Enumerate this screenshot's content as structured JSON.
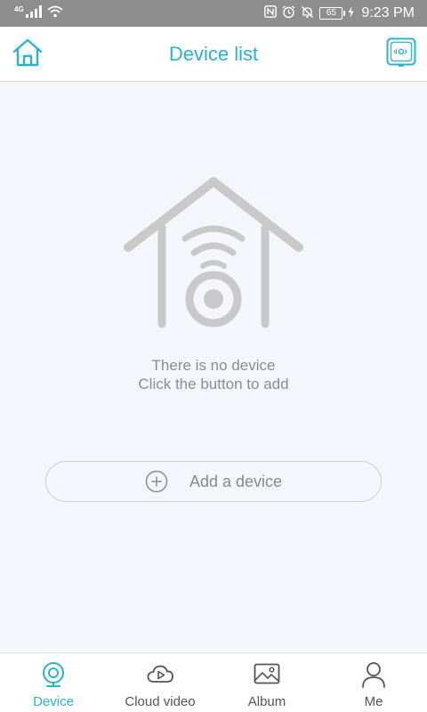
{
  "status_bar": {
    "network": "4G",
    "battery": "65",
    "time": "9:23 PM"
  },
  "header": {
    "title": "Device list",
    "left_icon": "home-icon",
    "right_icon": "scan-icon"
  },
  "empty_state": {
    "line1": "There is no device",
    "line2": "Click the button to add",
    "icon": "house-camera-icon"
  },
  "add_device": {
    "label": "Add a device",
    "icon": "plus-circle-icon"
  },
  "bottom_nav": {
    "items": [
      {
        "label": "Device",
        "icon": "camera-icon",
        "active": true
      },
      {
        "label": "Cloud video",
        "icon": "cloud-play-icon",
        "active": false
      },
      {
        "label": "Album",
        "icon": "image-icon",
        "active": false
      },
      {
        "label": "Me",
        "icon": "person-icon",
        "active": false
      }
    ]
  },
  "colors": {
    "accent": "#28b3cf",
    "background": "#f4f6fb",
    "status_bar": "#8e8e8e",
    "muted_text": "#8d8d8d"
  }
}
